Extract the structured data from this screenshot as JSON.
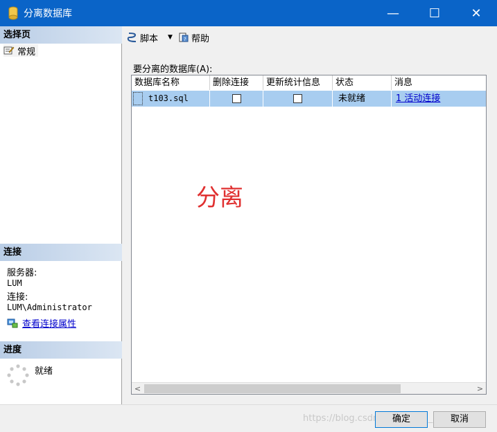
{
  "window": {
    "title": "分离数据库",
    "minimize": "—",
    "maximize": "☐",
    "close": "✕"
  },
  "left": {
    "select_page_header": "选择页",
    "nav_items": [
      "常规"
    ],
    "connection_header": "连接",
    "server_label": "服务器:",
    "server_value": "LUM",
    "connection_label": "连接:",
    "connection_value": "LUM\\Administrator",
    "view_properties_link": "查看连接属性",
    "progress_header": "进度",
    "progress_status": "就绪"
  },
  "toolbar": {
    "script_label": "脚本",
    "help_label": "帮助"
  },
  "main": {
    "db_label": "要分离的数据库(A):",
    "columns": [
      "数据库名称",
      "删除连接",
      "更新统计信息",
      "状态",
      "消息"
    ],
    "rows": [
      {
        "name": "t103.sql",
        "drop_connections": false,
        "update_statistics": false,
        "status": "未就绪",
        "message": "1 活动连接"
      }
    ],
    "overlay_text": "分离"
  },
  "footer": {
    "ok_label": "确定",
    "cancel_label": "取消",
    "watermark": "https://blog.csdn.net/weixin_46101030"
  },
  "colors": {
    "titlebar": "#0a64c8",
    "selected_row": "#a8cdf0",
    "overlay_red": "#e03030",
    "link": "#0000cc"
  }
}
